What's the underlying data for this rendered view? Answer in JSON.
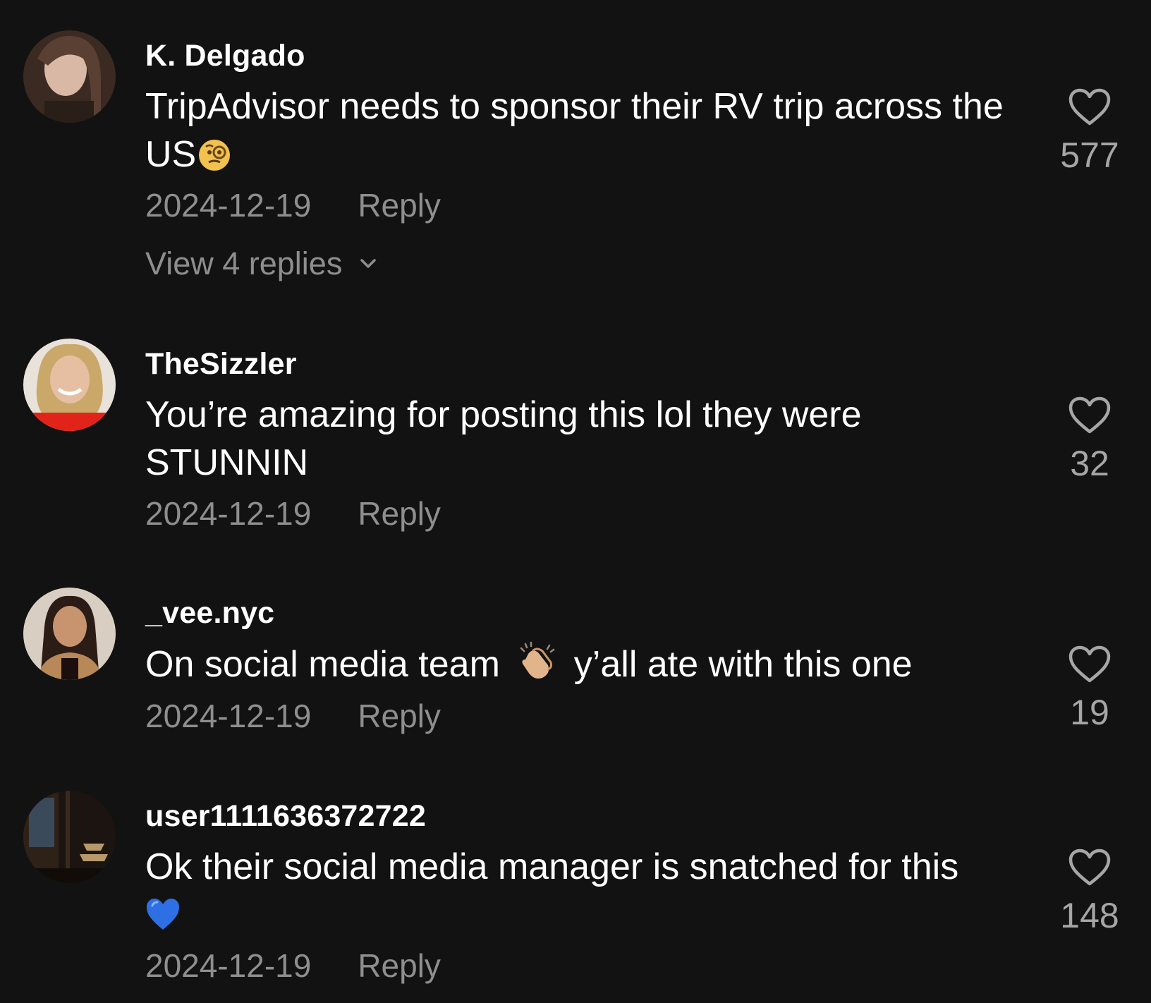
{
  "comments": [
    {
      "username": "K. Delgado",
      "text": "TripAdvisor needs to sponsor their RV trip across the US",
      "emoji": "face-with-monocle-emoji",
      "date": "2024-12-19",
      "reply_label": "Reply",
      "view_replies": "View 4 replies",
      "likes": "577"
    },
    {
      "username": "TheSizzler",
      "text": "You’re amazing for posting this lol they were STUNNIN",
      "date": "2024-12-19",
      "reply_label": "Reply",
      "likes": "32"
    },
    {
      "username": "_vee.nyc",
      "text_before": "On social media team",
      "emoji": "clapping-hands-emoji",
      "text_after": "y’all ate with this one",
      "date": "2024-12-19",
      "reply_label": "Reply",
      "likes": "19"
    },
    {
      "username": "user1111636372722",
      "text": "Ok their social media manager is snatched for this",
      "emoji": "blue-heart-emoji",
      "date": "2024-12-19",
      "reply_label": "Reply",
      "likes": "148"
    }
  ],
  "colors": {
    "background": "#121212",
    "primary_text": "#ffffff",
    "secondary_text": "#8e8e8e",
    "like_count": "#a6a6a6"
  }
}
